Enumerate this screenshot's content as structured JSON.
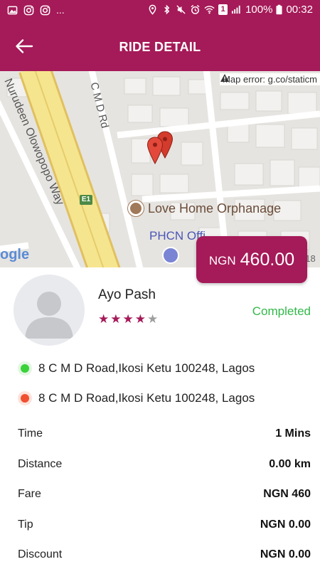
{
  "status_bar": {
    "dots": "...",
    "battery": "100%",
    "time": "00:32",
    "sim": "1"
  },
  "header": {
    "title": "RIDE DETAIL"
  },
  "map": {
    "error_text": "Map error: g.co/staticm",
    "streets": [
      "Nurudeen Olowopopo Way",
      "C M D Rd"
    ],
    "road_shield": "E1",
    "place": "Love Home Orphanage",
    "poi": "PHCN Offi",
    "attribution": "ogle",
    "year": "018"
  },
  "fare_badge": {
    "currency": "NGN",
    "amount": "460.00"
  },
  "driver": {
    "name": "Ayo Pash",
    "rating": 4,
    "rating_max": 5,
    "status": "Completed"
  },
  "addresses": {
    "pickup": "8 C M D Road,Ikosi Ketu 100248, Lagos",
    "dropoff": "8 C M D Road,Ikosi Ketu 100248, Lagos"
  },
  "details": [
    {
      "label": "Time",
      "value": "1 Mins"
    },
    {
      "label": "Distance",
      "value": "0.00 km"
    },
    {
      "label": "Fare",
      "value": "NGN 460"
    },
    {
      "label": "Tip",
      "value": "NGN 0.00"
    },
    {
      "label": "Discount",
      "value": "NGN 0.00"
    }
  ],
  "colors": {
    "primary": "#a51a58",
    "completed": "#33b84a",
    "pickup": "#39d239",
    "dropoff": "#f05030",
    "star_empty": "#9e9e9e"
  }
}
